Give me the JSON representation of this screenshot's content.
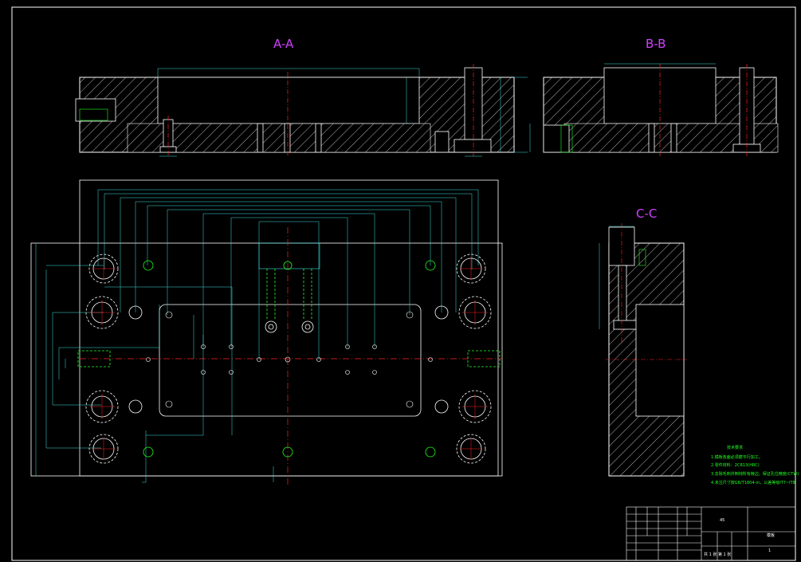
{
  "colors": {
    "background": "#000000",
    "outline": "#ffffff",
    "section_label": "#d040ff",
    "dimension": "#40e0e0",
    "dimension_text": "#e8e800",
    "centerline": "#ff2020",
    "hidden": "#20ff20",
    "notes": "#20ff20"
  },
  "labels": {
    "section_aa": "A-A",
    "section_bb": "B-B",
    "section_cc": "C-C"
  },
  "notes": {
    "title": "技术要求",
    "items": [
      "1.模板各面必须磨平行加工。",
      "2.零件材料：2CR13(HRC)",
      "3.去除毛刺并倒钝所有棱边，保证孔位精度(CTW)",
      "4.未注尺寸按GB/T1804-m，公差等级IT7~IT8"
    ]
  },
  "title_block": {
    "material": "45",
    "drawing_name": "模板",
    "scale": "1",
    "sheet": "共 1 张   第 1 张"
  }
}
